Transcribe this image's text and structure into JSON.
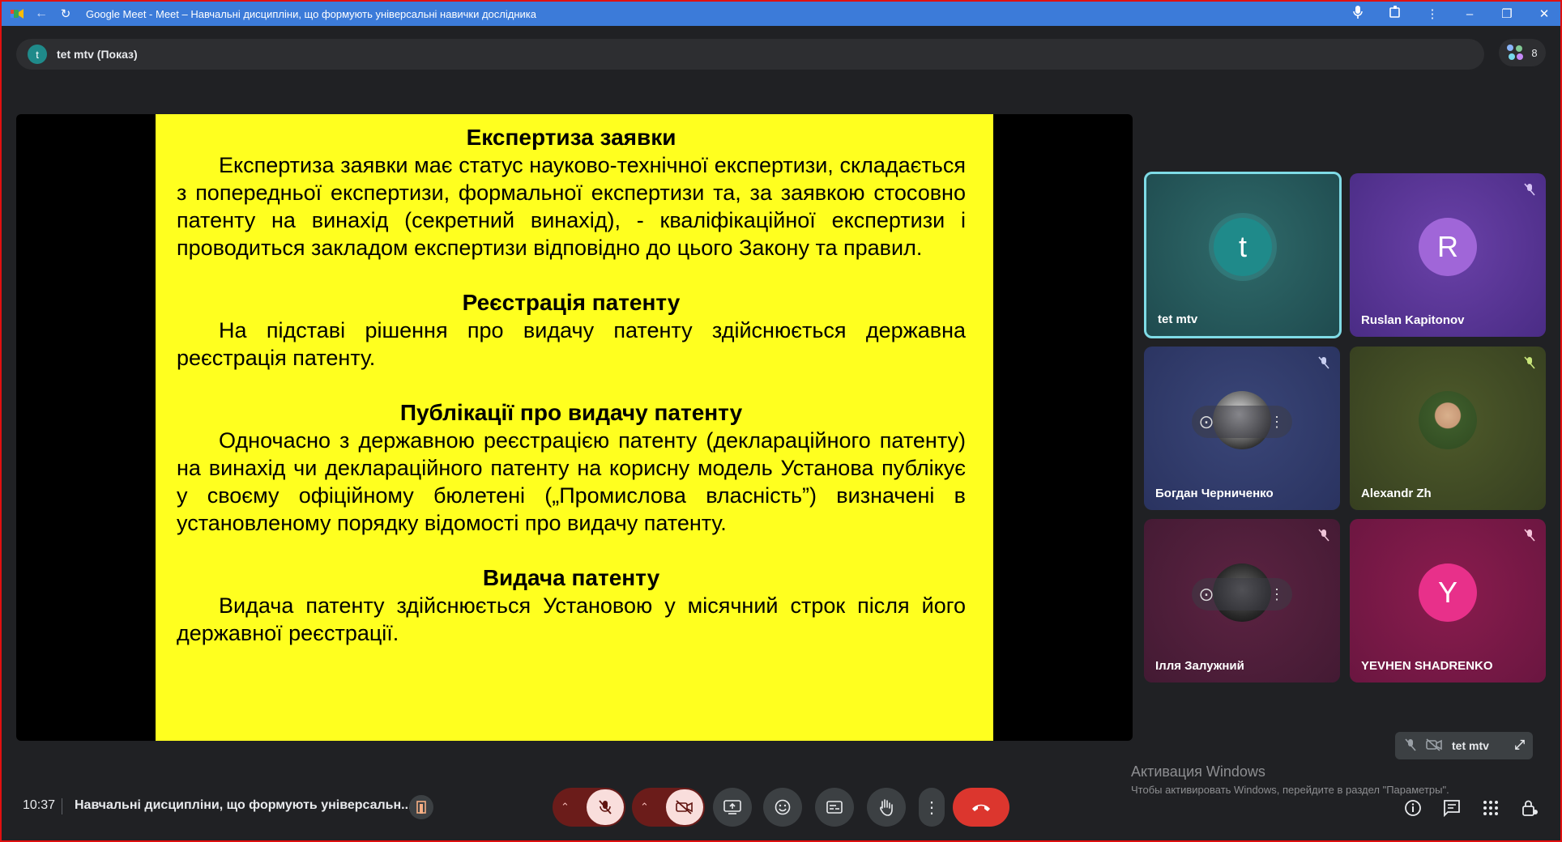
{
  "browser": {
    "title": "Google Meet - Meet – Навчальні дисципліни, що формують універсальні навички дослідника"
  },
  "presenter": {
    "initial": "t",
    "label": "tet mtv (Показ)"
  },
  "participants_count": "8",
  "slide": {
    "sections": [
      {
        "heading": "Експертиза заявки",
        "body": "Експертиза заявки має статус науково-технічної експертизи, складається з попередньої експертизи, формальної експертизи та, за заявкою стосовно патенту на винахід (секретний винахід), - кваліфікаційної експертизи і проводиться закладом експертизи відповідно до цього Закону та правил."
      },
      {
        "heading": "Реєстрація патенту",
        "body": "На підставі рішення про видачу патенту здійснюється державна реєстрація патенту."
      },
      {
        "heading": "Публікації про видачу патенту",
        "body": "Одночасно з державною реєстрацією патенту (деклараційного патенту) на винахід чи деклараційного патенту на корисну модель Установа публікує у своєму офіційному бюлетені („Промислова власність”) визначені в установленому порядку відомості про видачу патенту."
      },
      {
        "heading": "Видача патенту",
        "body": "Видача патенту здійснюється Установою у місячний строк після його державної реєстрації."
      }
    ]
  },
  "tiles": [
    {
      "name": "tet mtv",
      "initial": "t",
      "muted": false,
      "speaking": true
    },
    {
      "name": "Ruslan Kapitonov",
      "initial": "R",
      "muted": true
    },
    {
      "name": "Богдан Черниченко",
      "muted": true
    },
    {
      "name": "Alexandr Zh",
      "muted": true
    },
    {
      "name": "Ілля Залужний",
      "muted": true
    },
    {
      "name": "YEVHEN SHADRENKO",
      "initial": "Y",
      "muted": true
    }
  ],
  "self_view": {
    "name": "tet mtv"
  },
  "watermark": {
    "line1": "Активация Windows",
    "line2": "Чтобы активировать Windows, перейдите в раздел \"Параметры\"."
  },
  "bottom": {
    "time": "10:37",
    "meeting_title": "Навчальні дисципліни, що формують універсальн..."
  },
  "colors": {
    "accent_blue": "#3c7bd9",
    "slide_yellow": "#ffff1f",
    "end_call_red": "#dc362e",
    "muted_pink": "#f9dedc"
  }
}
